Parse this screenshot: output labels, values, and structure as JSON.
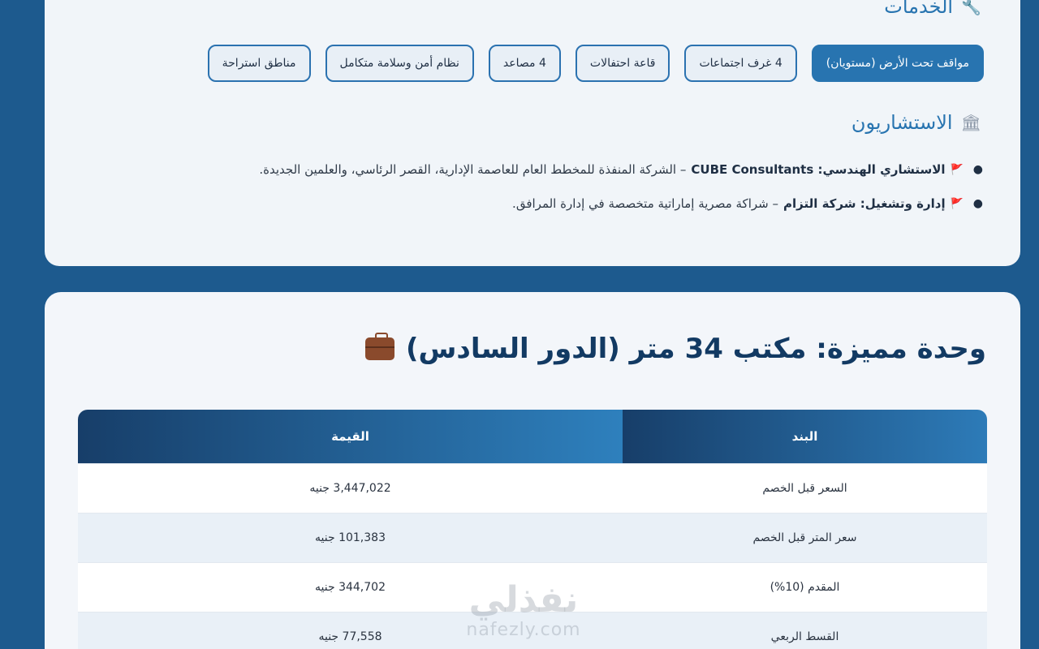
{
  "services": {
    "title": "الخدمات",
    "icon": "wrench-icon",
    "tags": [
      "مواقف تحت الأرض (مستويان)",
      "4 غرف اجتماعات",
      "قاعة احتفالات",
      "4 مصاعد",
      "نظام أمن وسلامة متكامل",
      "مناطق استراحة"
    ]
  },
  "consultants": {
    "title": "الاستشاريون",
    "icon": "bank-building-icon",
    "items": [
      {
        "label": "الاستشاري الهندسي: CUBE Consultants",
        "text": "– الشركة المنفذة للمخطط العام للعاصمة الإدارية، القصر الرئاسي، والعلمين الجديدة."
      },
      {
        "label": "إدارة وتشغيل: شركة التزام",
        "text": "– شراكة مصرية إماراتية متخصصة في إدارة المرافق."
      }
    ]
  },
  "unit": {
    "title": "وحدة مميزة: مكتب 34 متر (الدور السادس)",
    "icon": "briefcase-icon"
  },
  "table": {
    "headers": [
      "البند",
      "القيمة"
    ],
    "rows": [
      [
        "السعر قبل الخصم",
        "3,447,022 جنيه"
      ],
      [
        "سعر المتر قبل الخصم",
        "101,383 جنيه"
      ],
      [
        "المقدم (10%)",
        "344,702 جنيه"
      ],
      [
        "القسط الربعي",
        "77,558 جنيه"
      ]
    ]
  },
  "watermark": {
    "arabic": "نفذلي",
    "latin": "nafezly.com"
  },
  "colors": {
    "background": "#1d5a8e",
    "accent": "#2874b0",
    "heading": "#123a63"
  }
}
